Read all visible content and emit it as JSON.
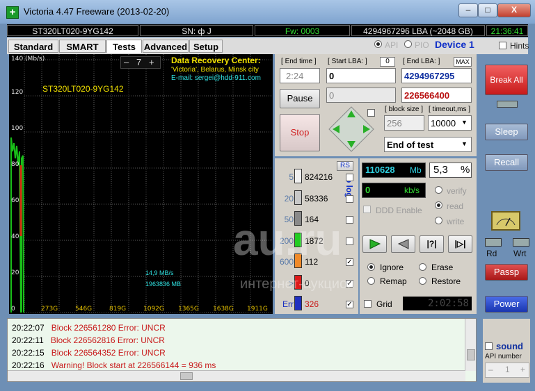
{
  "window": {
    "title": "Victoria 4.47  Freeware (2013-02-20)",
    "app_icon_glyph": "+",
    "minimize_glyph": "–",
    "maximize_glyph": "□",
    "close_glyph": "X"
  },
  "infobar": {
    "model": "ST320LT020-9YG142",
    "serial": "SN: ф J",
    "firmware": "Fw: 0003",
    "capacity": "4294967296 LBA (~2048 GB)",
    "clock": "21:36:41"
  },
  "tabs": [
    {
      "label": "Standard",
      "active": false
    },
    {
      "label": "SMART",
      "active": false
    },
    {
      "label": "Tests",
      "active": true
    },
    {
      "label": "Advanced",
      "active": false
    },
    {
      "label": "Setup",
      "active": false
    }
  ],
  "mode": {
    "api_label": "API",
    "pio_label": "PIO",
    "api_selected": true,
    "device": "Device 1",
    "hints_label": "Hints"
  },
  "graph": {
    "y_unit": "140 (Mb/s)",
    "y_ticks": [
      "120",
      "100",
      "80",
      "60",
      "40",
      "20",
      "0"
    ],
    "x_ticks": [
      "273G",
      "546G",
      "819G",
      "1092G",
      "1365G",
      "1638G",
      "1911G"
    ],
    "zoom_minus": "–",
    "zoom_value": "7",
    "zoom_plus": "+",
    "drive_label": "ST320LT020-9YG142",
    "speed_readout": "14,9 MB/s",
    "position_readout": "1963836 MB",
    "recovery_title": "Data Recovery Center:",
    "recovery_line1": "'Victoria', Belarus, Minsk city",
    "recovery_line2": "E-mail: sergei@hdd-911.com",
    "colors": {
      "background": "#000000",
      "grid": "#5a5a5a",
      "trace_green": "#19c019",
      "trace_red": "#d62a10"
    }
  },
  "test_control": {
    "end_time_label": "End time",
    "end_time_value": "2:24",
    "start_lba_label": "Start LBA:",
    "start_lba_small": "0",
    "start_lba_value": "0",
    "start_lba_current": "0",
    "end_lba_label": "End LBA:",
    "end_lba_max": "MAX",
    "end_lba_value": "4294967295",
    "end_lba_current": "226566400",
    "pause_label": "Pause",
    "stop_label": "Stop",
    "block_size_label": "block size",
    "block_size_value": "256",
    "timeout_label": "timeout,ms",
    "timeout_value": "10000",
    "end_action_value": "End of test"
  },
  "legend": {
    "rs_label": "RS",
    "to_log_label": "to log:",
    "rows": [
      {
        "threshold": "5",
        "count": "824216",
        "color": "#f0f0f0",
        "log": false
      },
      {
        "threshold": "20",
        "count": "58336",
        "color": "#c8c8c8",
        "log": false
      },
      {
        "threshold": "50",
        "count": "164",
        "color": "#8a8a8a",
        "log": false
      },
      {
        "threshold": "200",
        "count": "1872",
        "color": "#22cc22",
        "log": false
      },
      {
        "threshold": "600",
        "count": "112",
        "color": "#f08a2a",
        "log": true
      },
      {
        "threshold": ">",
        "count": "0",
        "color": "#dd1a1a",
        "log": true
      },
      {
        "threshold": "Err",
        "count": "326",
        "color": "#2030c0",
        "log": true
      }
    ]
  },
  "stats": {
    "position_value": "110628",
    "position_unit": "Mb",
    "percent_value": "5,3",
    "percent_unit": "%",
    "speed_value": "0",
    "speed_unit": "kb/s",
    "verify_label": "verify",
    "read_label": "read",
    "write_label": "write",
    "ddd_label": "DDD Enable",
    "ignore_label": "Ignore",
    "erase_label": "Erase",
    "remap_label": "Remap",
    "restore_label": "Restore",
    "grid_label": "Grid",
    "grid_timer": "2:02:58"
  },
  "right_panel": {
    "break_all_label": "Break All",
    "sleep_label": "Sleep",
    "recall_label": "Recall",
    "rd_label": "Rd",
    "wrt_label": "Wrt",
    "passp_label": "Passp",
    "power_label": "Power",
    "sound_label": "sound",
    "api_number_label": "API number",
    "api_number_value": "1"
  },
  "log": {
    "lines": [
      {
        "time": "20:22:07",
        "text": "Block 226561280 Error: UNCR"
      },
      {
        "time": "20:22:11",
        "text": "Block 226562816 Error: UNCR"
      },
      {
        "time": "20:22:15",
        "text": "Block 226564352 Error: UNCR"
      },
      {
        "time": "20:22:16",
        "text": "Warning! Block start at 226566144 = 936 ms"
      }
    ]
  },
  "watermark": {
    "main": "au.ru",
    "sub": "интернет-аукцион"
  }
}
